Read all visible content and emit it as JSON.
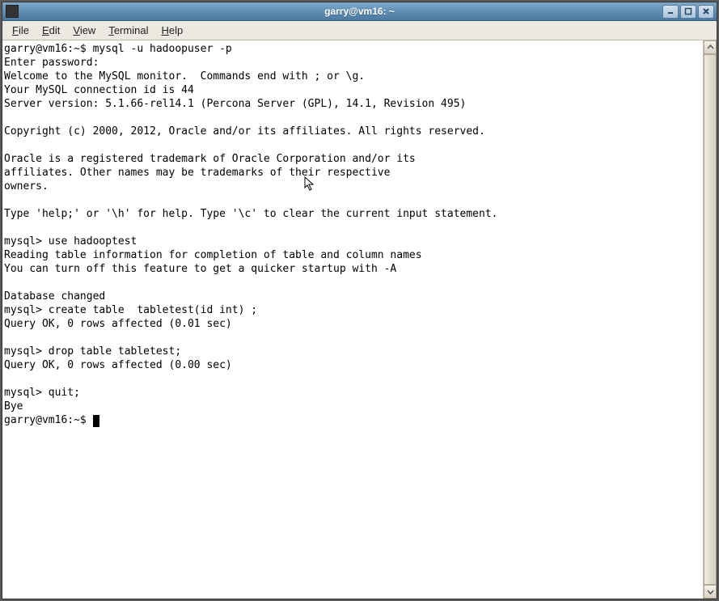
{
  "window": {
    "title": "garry@vm16: ~"
  },
  "menubar": {
    "file": "File",
    "edit": "Edit",
    "view": "View",
    "terminal": "Terminal",
    "help": "Help"
  },
  "terminal": {
    "lines": [
      "garry@vm16:~$ mysql -u hadoopuser -p",
      "Enter password:",
      "Welcome to the MySQL monitor.  Commands end with ; or \\g.",
      "Your MySQL connection id is 44",
      "Server version: 5.1.66-rel14.1 (Percona Server (GPL), 14.1, Revision 495)",
      "",
      "Copyright (c) 2000, 2012, Oracle and/or its affiliates. All rights reserved.",
      "",
      "Oracle is a registered trademark of Oracle Corporation and/or its",
      "affiliates. Other names may be trademarks of their respective",
      "owners.",
      "",
      "Type 'help;' or '\\h' for help. Type '\\c' to clear the current input statement.",
      "",
      "mysql> use hadooptest",
      "Reading table information for completion of table and column names",
      "You can turn off this feature to get a quicker startup with -A",
      "",
      "Database changed",
      "mysql> create table  tabletest(id int) ;",
      "Query OK, 0 rows affected (0.01 sec)",
      "",
      "mysql> drop table tabletest;",
      "Query OK, 0 rows affected (0.00 sec)",
      "",
      "mysql> quit;",
      "Bye"
    ],
    "prompt": "garry@vm16:~$ "
  }
}
